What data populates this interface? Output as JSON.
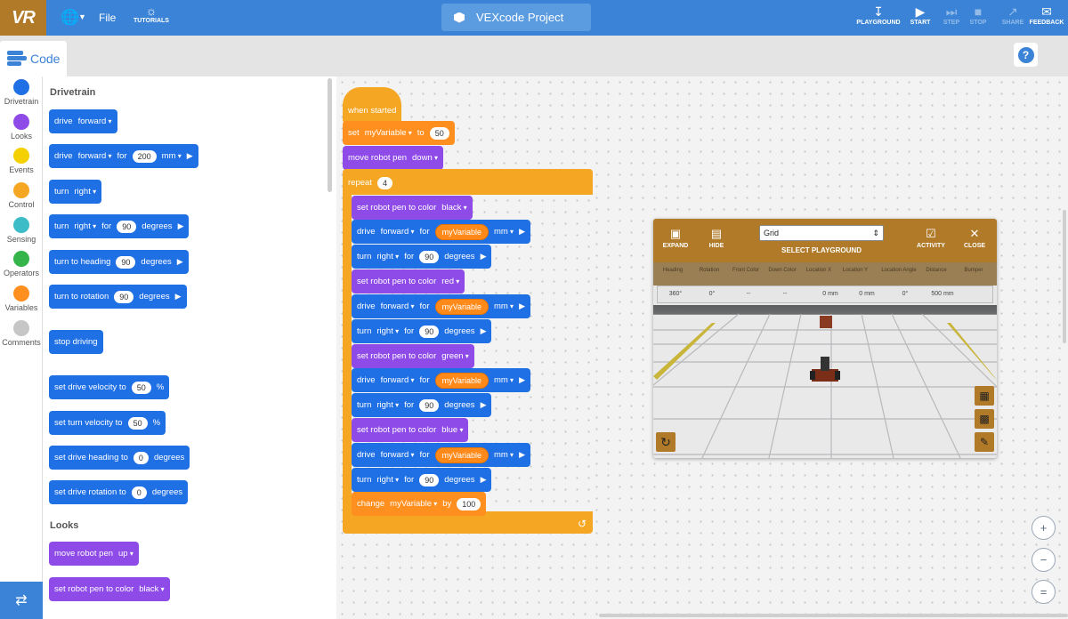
{
  "topbar": {
    "logo": "VR",
    "file_label": "File",
    "tutorials_label": "TUTORIALS",
    "project_name": "VEXcode Project",
    "playground_label": "PLAYGROUND",
    "start_label": "START",
    "step_label": "STEP",
    "stop_label": "STOP",
    "share_label": "SHARE",
    "feedback_label": "FEEDBACK"
  },
  "subbar": {
    "code_tab_label": "Code",
    "help_label": "?"
  },
  "categories": [
    {
      "label": "Drivetrain",
      "color": "#1f6fe5"
    },
    {
      "label": "Looks",
      "color": "#8e4be8"
    },
    {
      "label": "Events",
      "color": "#f5d000"
    },
    {
      "label": "Control",
      "color": "#f5a623"
    },
    {
      "label": "Sensing",
      "color": "#3cbcc7"
    },
    {
      "label": "Operators",
      "color": "#35b44a"
    },
    {
      "label": "Variables",
      "color": "#ff8f1f"
    },
    {
      "label": "Comments",
      "color": "#c6c6c6"
    }
  ],
  "palette": {
    "drivetrain_heading": "Drivetrain",
    "looks_heading": "Looks",
    "b1": {
      "a": "drive",
      "b": "forward"
    },
    "b2": {
      "a": "drive",
      "b": "forward",
      "c": "for",
      "d": "200",
      "e": "mm"
    },
    "b3": {
      "a": "turn",
      "b": "right"
    },
    "b4": {
      "a": "turn",
      "b": "right",
      "c": "for",
      "d": "90",
      "e": "degrees"
    },
    "b5": {
      "a": "turn to heading",
      "b": "90",
      "c": "degrees"
    },
    "b6": {
      "a": "turn to rotation",
      "b": "90",
      "c": "degrees"
    },
    "b7": {
      "a": "stop driving"
    },
    "b8": {
      "a": "set drive velocity to",
      "b": "50",
      "c": "%"
    },
    "b9": {
      "a": "set turn velocity to",
      "b": "50",
      "c": "%"
    },
    "b10": {
      "a": "set drive heading to",
      "b": "0",
      "c": "degrees"
    },
    "b11": {
      "a": "set drive rotation to",
      "b": "0",
      "c": "degrees"
    },
    "b12": {
      "a": "move robot pen",
      "b": "up"
    },
    "b13": {
      "a": "set robot pen to color",
      "b": "black"
    }
  },
  "script": {
    "when_started": "when started",
    "set": {
      "a": "set",
      "b": "myVariable",
      "c": "to",
      "d": "50"
    },
    "pen": {
      "a": "move robot pen",
      "b": "down"
    },
    "repeat": {
      "a": "repeat",
      "b": "4"
    },
    "colors": [
      "black",
      "red",
      "green",
      "blue"
    ],
    "set_color_label": "set robot pen to color",
    "drive": {
      "a": "drive",
      "b": "forward",
      "c": "for",
      "d": "myVariable",
      "e": "mm"
    },
    "turn": {
      "a": "turn",
      "b": "right",
      "c": "for",
      "d": "90",
      "e": "degrees"
    },
    "change": {
      "a": "change",
      "b": "myVariable",
      "c": "by",
      "d": "100"
    }
  },
  "playground": {
    "expand_label": "EXPAND",
    "hide_label": "HIDE",
    "activity_label": "ACTIVITY",
    "close_label": "CLOSE",
    "select_value": "Grid",
    "select_label": "SELECT PLAYGROUND",
    "headers": [
      "Heading",
      "Rotation",
      "Front Color",
      "Down Color",
      "Location X",
      "Location Y",
      "Location Angle",
      "Distance",
      "Bumper"
    ],
    "values": [
      "360°",
      "0°",
      "--",
      "--",
      "0 mm",
      "0 mm",
      "0°",
      "500 mm",
      ""
    ]
  },
  "zoom": {
    "in": "+",
    "out": "−",
    "reset": "="
  }
}
